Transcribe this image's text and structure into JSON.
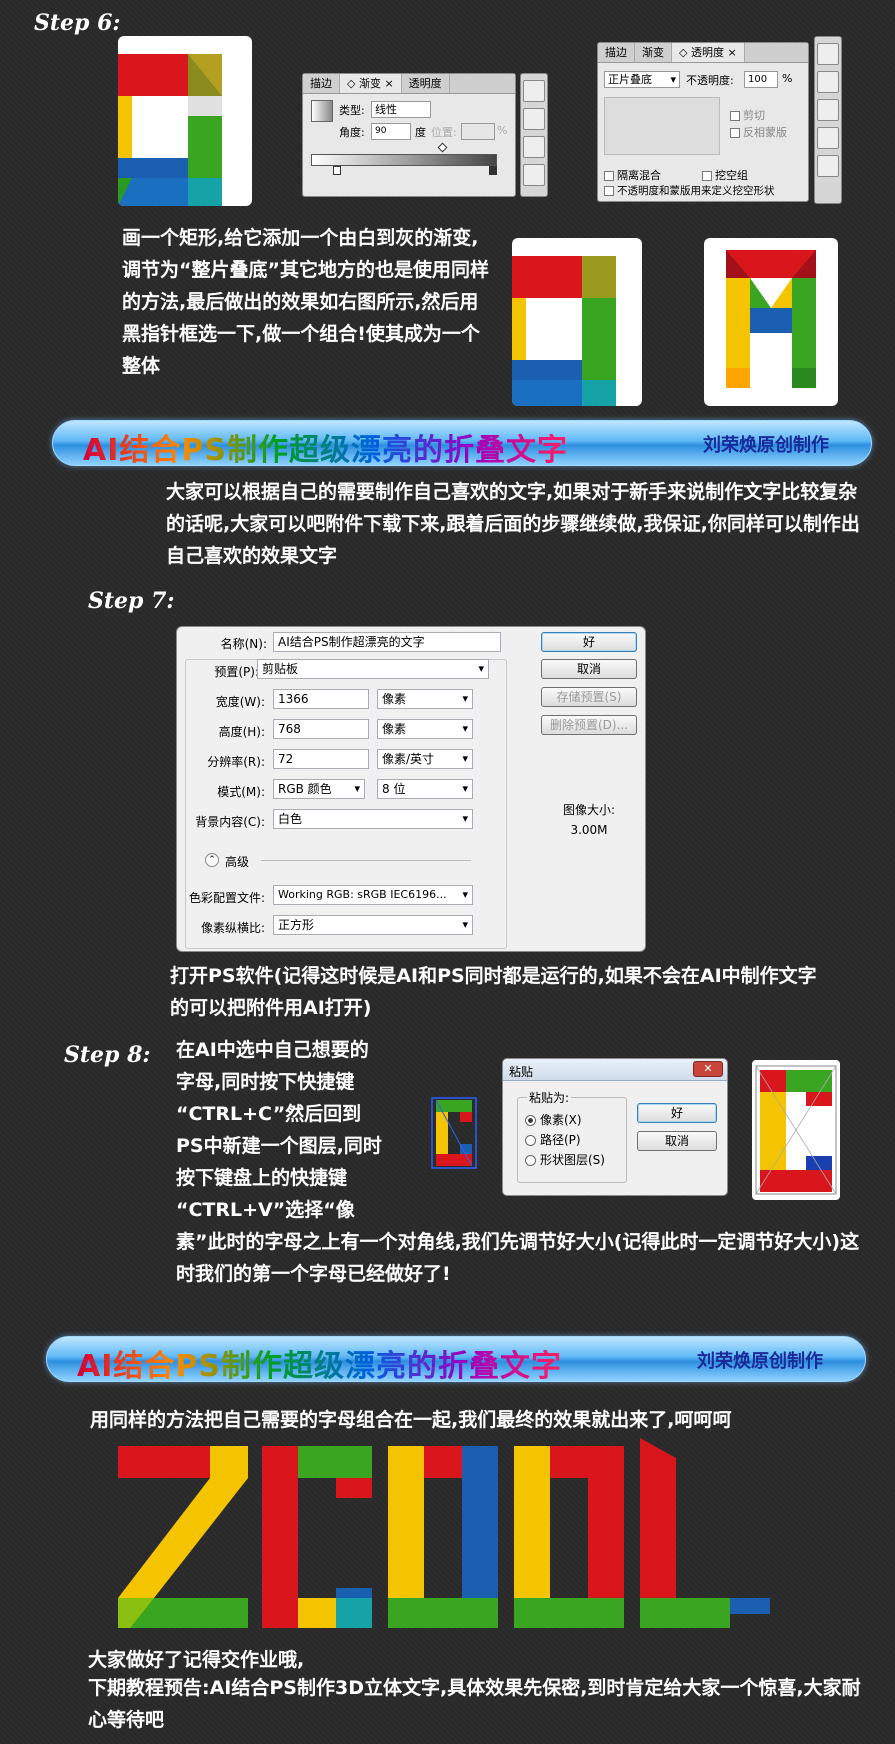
{
  "step6": {
    "label": "Step 6:",
    "gradient_panel": {
      "tabs": [
        "描边",
        "◇ 渐变 ×",
        "透明度"
      ],
      "type_label": "类型:",
      "type_value": "线性",
      "angle_label": "角度:",
      "angle_value": "90",
      "angle_unit": "度",
      "position_label": "位置:",
      "percent": "%"
    },
    "transparency_panel": {
      "tabs": [
        "描边",
        "渐变",
        "◇ 透明度 ×"
      ],
      "blend_mode": "正片叠底",
      "opacity_label": "不透明度:",
      "opacity_value": "100",
      "percent": "%",
      "clip": "剪切",
      "invert_mask": "反相蒙版",
      "isolate_blend": "隔离混合",
      "knockout_group": "挖空组",
      "opacity_mask_knockout": "不透明度和蒙版用来定义挖空形状"
    },
    "description": "画一个矩形,给它添加一个由白到灰的渐变,调节为“整片叠底”其它地方的也是使用同样的方法,最后做出的效果如右图所示,然后用黑指针框选一下,做一个组合!使其成为一个整体"
  },
  "banner": {
    "title": "AI结合PS制作超级漂亮的折叠文字",
    "credit": "刘荣焕原创制作"
  },
  "intro_text": "大家可以根据自己的需要制作自己喜欢的文字,如果对于新手来说制作文字比较复杂的话呢,大家可以吧附件下载下来,跟着后面的步骤继续做,我保证,你同样可以制作出自己喜欢的效果文字",
  "step7": {
    "label": "Step 7:",
    "dialog": {
      "name_label": "名称(N):",
      "name_value": "AI结合PS制作超漂亮的文字",
      "preset_label": "预置(P):",
      "preset_value": "剪贴板",
      "width_label": "宽度(W):",
      "width_value": "1366",
      "width_unit": "像素",
      "height_label": "高度(H):",
      "height_value": "768",
      "height_unit": "像素",
      "resolution_label": "分辨率(R):",
      "resolution_value": "72",
      "resolution_unit": "像素/英寸",
      "mode_label": "模式(M):",
      "mode_value": "RGB 颜色",
      "bit_value": "8 位",
      "bg_label": "背景内容(C):",
      "bg_value": "白色",
      "advanced": "高级",
      "color_profile_label": "色彩配置文件:",
      "color_profile_value": "Working RGB:  sRGB IEC6196...",
      "pixel_aspect_label": "像素纵横比:",
      "pixel_aspect_value": "正方形",
      "ok": "好",
      "cancel": "取消",
      "save_preset": "存储预置(S)",
      "delete_preset": "删除预置(D)...",
      "image_size_label": "图像大小:",
      "image_size_value": "3.00M"
    },
    "description": "打开PS软件(记得这时候是AI和PS同时都是运行的,如果不会在AI中制作文字的可以把附件用AI打开)"
  },
  "step8": {
    "label": "Step 8:",
    "description_lines": [
      "在AI中选中自己想要的",
      "字母,同时按下快捷键",
      "“CTRL+C”然后回到",
      "PS中新建一个图层,同时",
      "按下键盘上的快捷键",
      "“CTRL+V”选择“像"
    ],
    "description_tail": "素”此时的字母之上有一个对角线,我们先调节好大小(记得此时一定调节好大小)这时我们的第一个字母已经做好了!",
    "paste_dialog": {
      "title": "粘贴",
      "group_label": "粘贴为:",
      "opt_pixels": "像素(X)",
      "opt_path": "路径(P)",
      "opt_shape": "形状图层(S)",
      "ok": "好",
      "cancel": "取消"
    }
  },
  "final_text": "用同样的方法把自己需要的字母组合在一起,我们最终的效果就出来了,呵呵呵",
  "footer_line1": "大家做好了记得交作业哦,",
  "footer_line2": "下期教程预告:AI结合PS制作3D立体文字,具体效果先保密,到时肯定给大家一个惊喜,大家耐心等待吧",
  "colors": {
    "red": "#d9161c",
    "yellow": "#f5c400",
    "green": "#3aa520",
    "blue": "#1a5fb0",
    "olive": "#8a8a1e",
    "teal": "#16a3a8",
    "banner_blue": "#4aa8ef"
  }
}
